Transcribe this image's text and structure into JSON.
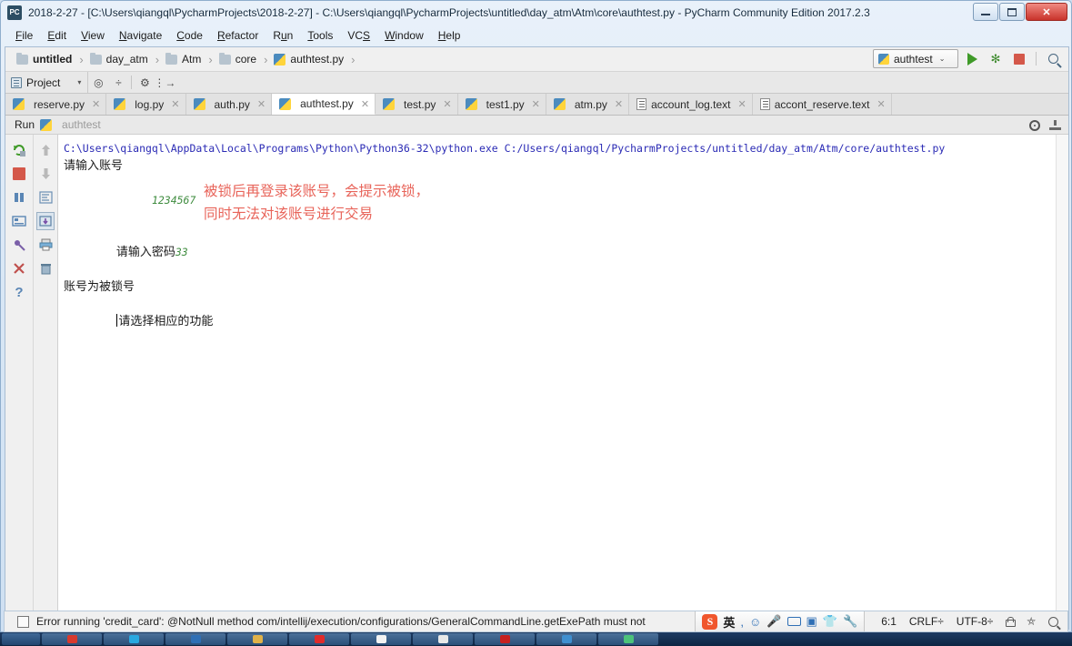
{
  "window": {
    "title": "2018-2-27 - [C:\\Users\\qiangql\\PycharmProjects\\2018-2-27] - C:\\Users\\qiangql\\PycharmProjects\\untitled\\day_atm\\Atm\\core\\authtest.py - PyCharm Community Edition 2017.2.3",
    "app_icon_label": "PC",
    "minimize_label": "Minimize",
    "maximize_label": "Maximize",
    "close_label": "✕"
  },
  "menubar": {
    "items": [
      {
        "label": "File"
      },
      {
        "label": "Edit"
      },
      {
        "label": "View"
      },
      {
        "label": "Navigate"
      },
      {
        "label": "Code"
      },
      {
        "label": "Refactor"
      },
      {
        "label": "Run"
      },
      {
        "label": "Tools"
      },
      {
        "label": "VCS"
      },
      {
        "label": "Window"
      },
      {
        "label": "Help"
      }
    ]
  },
  "breadcrumb": {
    "items": [
      {
        "label": "untitled",
        "type": "folder",
        "bold": true
      },
      {
        "label": "day_atm",
        "type": "folder",
        "bold": false
      },
      {
        "label": "Atm",
        "type": "folder",
        "bold": false
      },
      {
        "label": "core",
        "type": "folder",
        "bold": false
      },
      {
        "label": "authtest.py",
        "type": "python",
        "bold": false
      }
    ],
    "separator": "›"
  },
  "run_toolbar": {
    "config_name": "authtest",
    "chevron": "⌄",
    "run_icon": "run-icon",
    "debug_icon": "debug-icon",
    "stop_icon": "stop-icon",
    "search_icon": "search-icon"
  },
  "toolstrip": {
    "project_label": "Project",
    "dropdown": "▾",
    "icons": [
      "target-icon",
      "collapse-all-icon",
      "settings-icon",
      "expand-icon"
    ]
  },
  "editor_tabs": [
    {
      "label": "reserve.py",
      "type": "python",
      "active": false,
      "close": "✕"
    },
    {
      "label": "log.py",
      "type": "python",
      "active": false,
      "close": "✕"
    },
    {
      "label": "auth.py",
      "type": "python",
      "active": false,
      "close": "✕"
    },
    {
      "label": "authtest.py",
      "type": "python",
      "active": true,
      "close": "✕"
    },
    {
      "label": "test.py",
      "type": "python",
      "active": false,
      "close": "✕"
    },
    {
      "label": "test1.py",
      "type": "python",
      "active": false,
      "close": "✕"
    },
    {
      "label": "atm.py",
      "type": "python",
      "active": false,
      "close": "✕"
    },
    {
      "label": "account_log.text",
      "type": "text",
      "active": false,
      "close": "✕"
    },
    {
      "label": "accont_reserve.text",
      "type": "text",
      "active": false,
      "close": "✕"
    }
  ],
  "run_window": {
    "title": "Run",
    "config_label": "authtest",
    "settings_icon": "gear-icon",
    "hide_icon": "hide-window-icon",
    "left_toolbar": [
      {
        "name": "rerun-icon",
        "glyph": "↻"
      },
      {
        "name": "stop-icon",
        "glyph": "■"
      },
      {
        "name": "pause-output-icon",
        "glyph": "⏸"
      },
      {
        "name": "console-icon",
        "glyph": "▤"
      },
      {
        "name": "pin-icon",
        "glyph": "☂"
      },
      {
        "name": "close-icon",
        "glyph": "✕"
      },
      {
        "name": "help-icon",
        "glyph": "?"
      }
    ],
    "right_toolbar": [
      {
        "name": "up-arrow-icon",
        "glyph": "⬆"
      },
      {
        "name": "down-arrow-icon",
        "glyph": "⬇"
      },
      {
        "name": "soft-wrap-icon",
        "glyph": "↵"
      },
      {
        "name": "scroll-to-end-icon",
        "glyph": "⬇"
      },
      {
        "name": "print-icon",
        "glyph": "⎙"
      },
      {
        "name": "clear-all-icon",
        "glyph": "Ὕ1"
      }
    ]
  },
  "console": {
    "command_line": "C:\\Users\\qiangql\\AppData\\Local\\Programs\\Python\\Python36-32\\python.exe C:/Users/qiangql/PycharmProjects/untitled/day_atm/Atm/core/authtest.py",
    "line_prompt_account": "请输入账号",
    "input_account": "1234567",
    "line_prompt_password": "请输入密码",
    "input_password": "33",
    "line_locked": "账号为被锁号",
    "line_choose": "请选择相应的功能",
    "annotation": "被锁后再登录该账号，会提示被锁，\n同时无法对该账号进行交易",
    "annotation_color": "#e8645a",
    "echo_color": "#3f8c3f",
    "command_color": "#2b2bb5"
  },
  "statusbar": {
    "message": "Error running 'credit_card': @NotNull method com/intellij/execution/configurations/GeneralCommandLine.getExePath must not",
    "caret_position": "6:1",
    "line_separator": "CRLF÷",
    "encoding": "UTF-8÷",
    "lock_icon": "lock-icon",
    "hierarchy_icon": "hierarchy-icon",
    "search_icon": "search-icon"
  },
  "ime": {
    "logo": "S",
    "mode": "英",
    "punctuation_icon": "punctuation-icon",
    "emoji_icon": "☺",
    "mic_icon": "⬤",
    "keyboard_icon": "keyboard-icon",
    "toolbox_icon": "toolbox-icon",
    "skin_icon": "skin-icon",
    "settings_icon": "wrench-icon"
  },
  "taskbar": {
    "items": [
      {
        "name": "taskbar-item-1",
        "color": "#d83a2e"
      },
      {
        "name": "taskbar-item-2",
        "color": "#29a8e0"
      },
      {
        "name": "taskbar-item-3",
        "color": "#2f6fb5"
      },
      {
        "name": "taskbar-item-4",
        "color": "#e0b24a"
      },
      {
        "name": "taskbar-item-5",
        "color": "#e02b2b"
      },
      {
        "name": "taskbar-item-6",
        "color": "#f2f2f2"
      },
      {
        "name": "taskbar-item-7",
        "color": "#e8e8e8"
      },
      {
        "name": "taskbar-item-8",
        "color": "#c62020"
      },
      {
        "name": "taskbar-item-9",
        "color": "#3f8fd0"
      },
      {
        "name": "taskbar-item-10",
        "color": "#4cc27a"
      }
    ]
  }
}
